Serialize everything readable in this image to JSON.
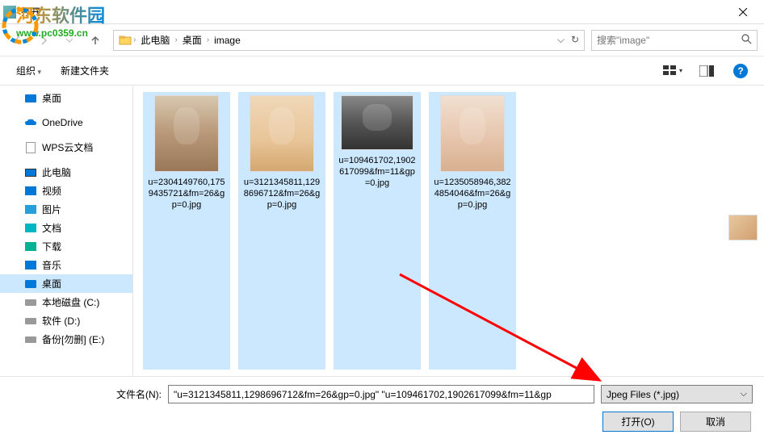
{
  "titlebar": {
    "title": "打开"
  },
  "watermark": {
    "text": "河东软件园",
    "url": "www.pc0359.cn"
  },
  "navbar": {
    "breadcrumb": [
      "此电脑",
      "桌面",
      "image"
    ],
    "search_placeholder": "搜索\"image\""
  },
  "toolbar": {
    "organize": "组织",
    "new_folder": "新建文件夹"
  },
  "sidebar": {
    "items": [
      {
        "label": "桌面",
        "icon": "desktop",
        "level": 2
      },
      {
        "label": "OneDrive",
        "icon": "onedrive",
        "level": 1
      },
      {
        "label": "WPS云文档",
        "icon": "file",
        "level": 1
      },
      {
        "label": "此电脑",
        "icon": "thispc",
        "level": 1
      },
      {
        "label": "视频",
        "icon": "folder-video",
        "level": 2
      },
      {
        "label": "图片",
        "icon": "folder-pic",
        "level": 2
      },
      {
        "label": "文档",
        "icon": "folder-doc",
        "level": 2
      },
      {
        "label": "下载",
        "icon": "folder-dl",
        "level": 2
      },
      {
        "label": "音乐",
        "icon": "folder-music",
        "level": 2
      },
      {
        "label": "桌面",
        "icon": "desktop",
        "level": 2,
        "selected": true
      },
      {
        "label": "本地磁盘 (C:)",
        "icon": "drive",
        "level": 2
      },
      {
        "label": "软件 (D:)",
        "icon": "drive",
        "level": 2
      },
      {
        "label": "备份[勿删] (E:)",
        "icon": "drive",
        "level": 2
      }
    ]
  },
  "files": [
    {
      "name": "u=2304149760,1759435721&fm=26&gp=0.jpg",
      "thumb": "photo1",
      "selected": true
    },
    {
      "name": "u=3121345811,1298696712&fm=26&gp=0.jpg",
      "thumb": "photo2",
      "selected": true
    },
    {
      "name": "u=109461702,1902617099&fm=11&gp=0.jpg",
      "thumb": "photo3",
      "selected": true
    },
    {
      "name": "u=1235058946,3824854046&fm=26&gp=0.jpg",
      "thumb": "photo4",
      "selected": true
    }
  ],
  "bottom": {
    "filename_label": "文件名(N):",
    "filename_value": "\"u=3121345811,1298696712&fm=26&gp=0.jpg\" \"u=109461702,1902617099&fm=11&gp",
    "filetype": "Jpeg Files (*.jpg)",
    "open_btn": "打开(O)",
    "cancel_btn": "取消"
  }
}
